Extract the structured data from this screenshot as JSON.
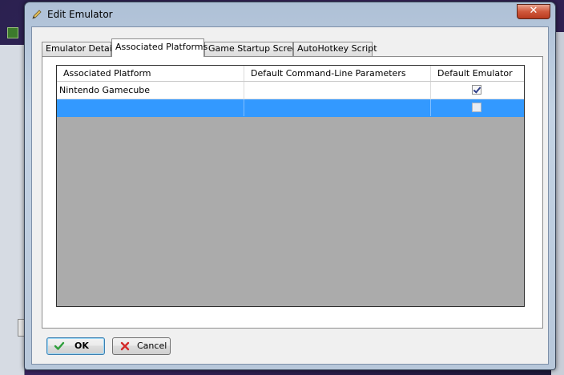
{
  "dialog": {
    "title": "Edit Emulator",
    "close_label": "✕"
  },
  "tabs": [
    {
      "label": "Emulator Details",
      "active": false
    },
    {
      "label": "Associated Platforms",
      "active": true
    },
    {
      "label": "Game Startup Screen",
      "active": false
    },
    {
      "label": "AutoHotkey Script",
      "active": false
    }
  ],
  "grid": {
    "columns": [
      "Associated Platform",
      "Default Command-Line Parameters",
      "Default Emulator"
    ],
    "rows": [
      {
        "platform": "Nintendo Gamecube",
        "params": "",
        "default_emulator": true,
        "selected": false
      },
      {
        "platform": "",
        "params": "",
        "default_emulator": false,
        "selected": true
      }
    ]
  },
  "buttons": {
    "ok_label": "OK",
    "cancel_label": "Cancel"
  },
  "colors": {
    "selection": "#3399ff",
    "empty_grid": "#ababab",
    "ok_icon": "#2e9e3a",
    "cancel_icon": "#d42a2a"
  }
}
